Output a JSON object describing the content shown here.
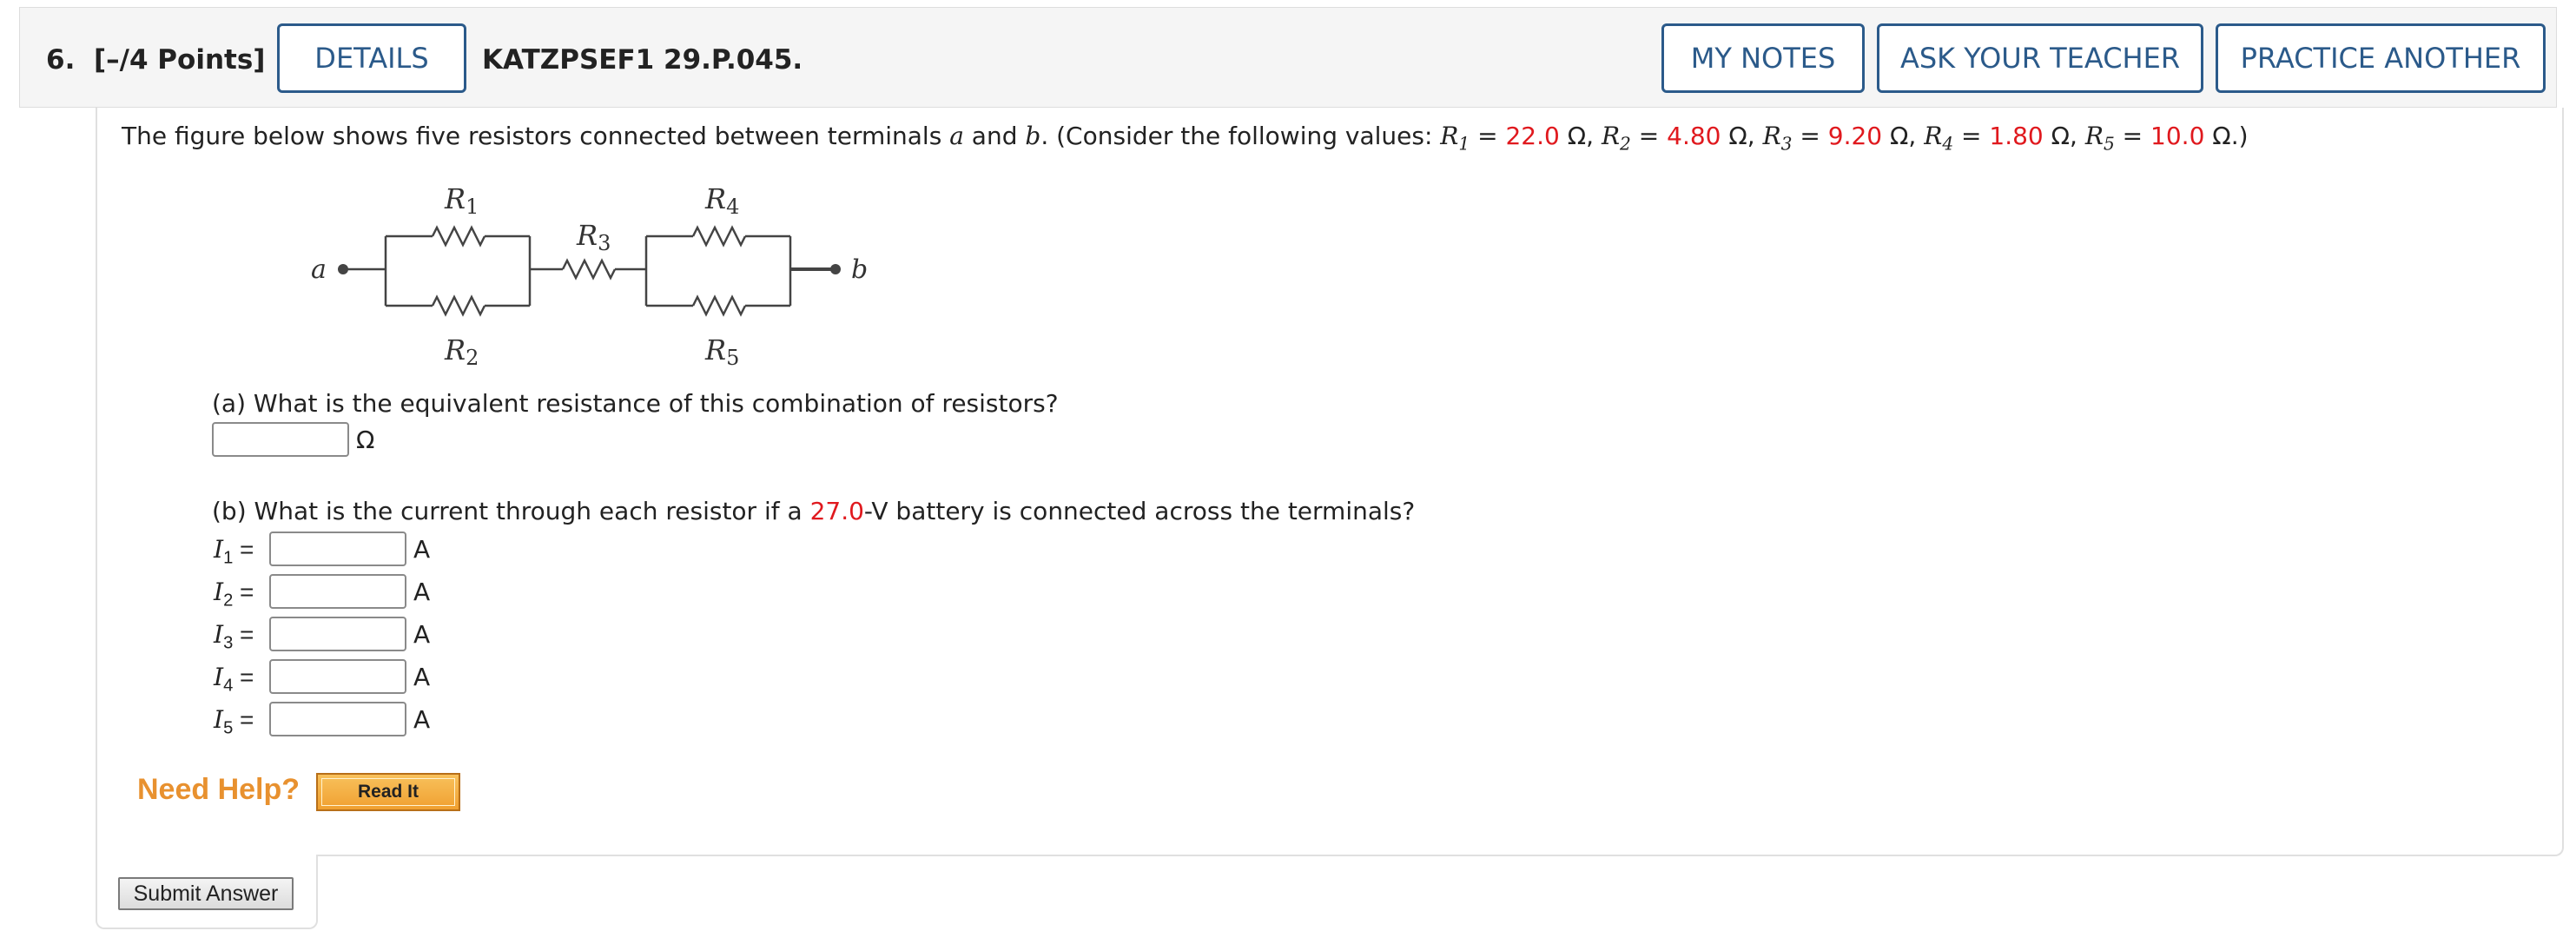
{
  "header": {
    "question_number": "6.",
    "points": "[–/4 Points]",
    "details_label": "DETAILS",
    "problem_code": "KATZPSEF1 29.P.045.",
    "my_notes_label": "MY NOTES",
    "ask_teacher_label": "ASK YOUR TEACHER",
    "practice_another_label": "PRACTICE ANOTHER"
  },
  "intro": {
    "prefix": "The figure below shows five resistors connected between terminals ",
    "a": "a",
    "and": " and ",
    "b": "b",
    "consider": ". (Consider the following values:  ",
    "close": ".)",
    "values": [
      {
        "symbol": "R",
        "sub": "1",
        "value": "22.0",
        "unit": " Ω"
      },
      {
        "symbol": "R",
        "sub": "2",
        "value": "4.80",
        "unit": " Ω"
      },
      {
        "symbol": "R",
        "sub": "3",
        "value": "9.20",
        "unit": " Ω"
      },
      {
        "symbol": "R",
        "sub": "4",
        "value": "1.80",
        "unit": " Ω"
      },
      {
        "symbol": "R",
        "sub": "5",
        "value": "10.0",
        "unit": " Ω"
      }
    ]
  },
  "figure": {
    "terminal_a": "a",
    "terminal_b": "b",
    "r1": "R",
    "r1_sub": "1",
    "r2": "R",
    "r2_sub": "2",
    "r3": "R",
    "r3_sub": "3",
    "r4": "R",
    "r4_sub": "4",
    "r5": "R",
    "r5_sub": "5"
  },
  "part_a": {
    "question": "(a) What is the equivalent resistance of this combination of resistors?",
    "value": "",
    "unit": "Ω"
  },
  "part_b": {
    "prefix": "(b) What is the current through each resistor if a ",
    "voltage": "27.0",
    "suffix": "-V battery is connected across the terminals?",
    "currents": [
      {
        "symbol": "I",
        "sub": "1",
        "eq": " =",
        "value": "",
        "unit": "A"
      },
      {
        "symbol": "I",
        "sub": "2",
        "eq": " =",
        "value": "",
        "unit": "A"
      },
      {
        "symbol": "I",
        "sub": "3",
        "eq": " =",
        "value": "",
        "unit": "A"
      },
      {
        "symbol": "I",
        "sub": "4",
        "eq": " =",
        "value": "",
        "unit": "A"
      },
      {
        "symbol": "I",
        "sub": "5",
        "eq": " =",
        "value": "",
        "unit": "A"
      }
    ]
  },
  "help": {
    "need_help": "Need Help?",
    "read_it": "Read It"
  },
  "submit_label": "Submit Answer",
  "colors": {
    "accent": "#2b5a8a",
    "highlight": "#e0191e",
    "help": "#e8912f"
  }
}
